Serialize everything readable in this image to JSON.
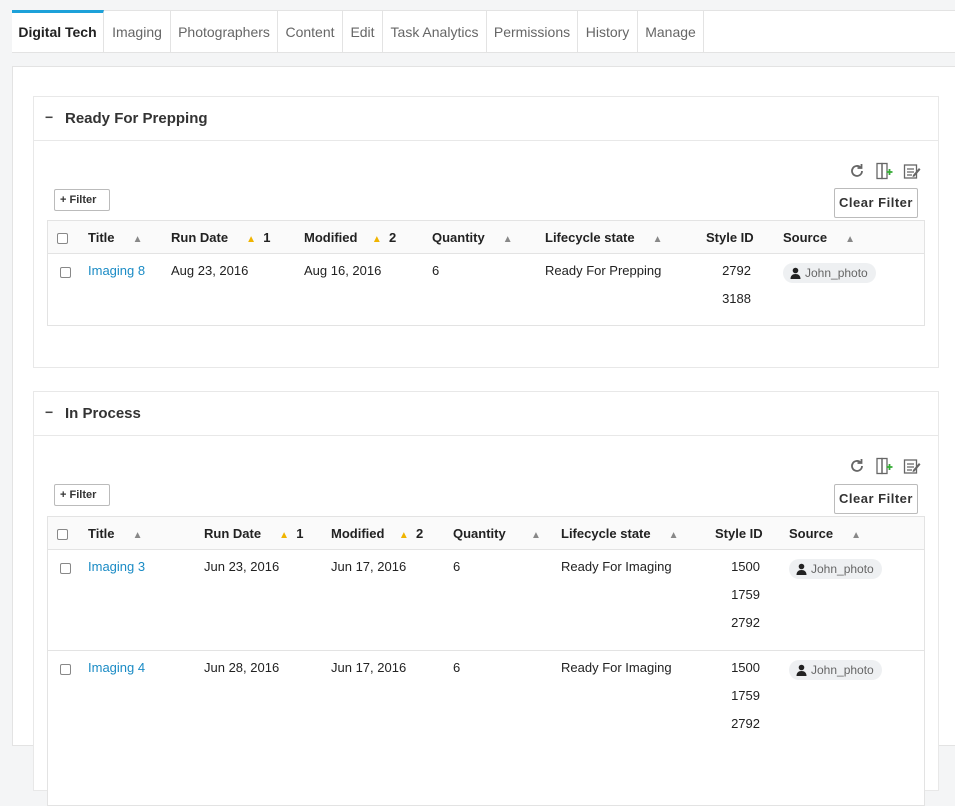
{
  "tabs": [
    {
      "label": "Digital Tech",
      "active": true
    },
    {
      "label": "Imaging"
    },
    {
      "label": "Photographers"
    },
    {
      "label": "Content"
    },
    {
      "label": "Edit"
    },
    {
      "label": "Task Analytics"
    },
    {
      "label": "Permissions"
    },
    {
      "label": "History"
    },
    {
      "label": "Manage"
    }
  ],
  "colors": {
    "accent": "#1da1d9",
    "link": "#1a8bc5",
    "sort_active": "#f0b400"
  },
  "icons": [
    "refresh-icon",
    "add-column-icon",
    "edit-list-icon",
    "person-icon"
  ],
  "panels": [
    {
      "collapse": "−",
      "title": "Ready For Prepping",
      "filter_label": "Filter",
      "clear_filter_label": "Clear Filter",
      "columns": [
        {
          "label": "Title",
          "sort": "▲"
        },
        {
          "label": "Run Date",
          "sort": "▲",
          "order": "1"
        },
        {
          "label": "Modified",
          "sort": "▲",
          "order": "2"
        },
        {
          "label": "Quantity",
          "sort": "▲"
        },
        {
          "label": "Lifecycle state",
          "sort": "▲"
        },
        {
          "label": "Style ID"
        },
        {
          "label": "Source",
          "sort": "▲"
        }
      ],
      "rows": [
        {
          "title": "Imaging 8",
          "run_date": "Aug 23, 2016",
          "modified": "Aug 16, 2016",
          "quantity": "6",
          "state": "Ready For Prepping",
          "style_ids": [
            "2792",
            "3188"
          ],
          "source": "John_photo"
        }
      ]
    },
    {
      "collapse": "−",
      "title": "In Process",
      "filter_label": "Filter",
      "clear_filter_label": "Clear Filter",
      "columns": [
        {
          "label": "Title",
          "sort": "▲"
        },
        {
          "label": "Run Date",
          "sort": "▲",
          "order": "1"
        },
        {
          "label": "Modified",
          "sort": "▲",
          "order": "2"
        },
        {
          "label": "Quantity",
          "sort": "▲"
        },
        {
          "label": "Lifecycle state",
          "sort": "▲"
        },
        {
          "label": "Style ID"
        },
        {
          "label": "Source",
          "sort": "▲"
        }
      ],
      "rows": [
        {
          "title": "Imaging 3",
          "run_date": "Jun 23, 2016",
          "modified": "Jun 17, 2016",
          "quantity": "6",
          "state": "Ready For Imaging",
          "style_ids": [
            "1500",
            "1759",
            "2792"
          ],
          "source": "John_photo"
        },
        {
          "title": "Imaging 4",
          "run_date": "Jun 28, 2016",
          "modified": "Jun 17, 2016",
          "quantity": "6",
          "state": "Ready For Imaging",
          "style_ids": [
            "1500",
            "1759",
            "2792"
          ],
          "source": "John_photo"
        }
      ]
    }
  ]
}
